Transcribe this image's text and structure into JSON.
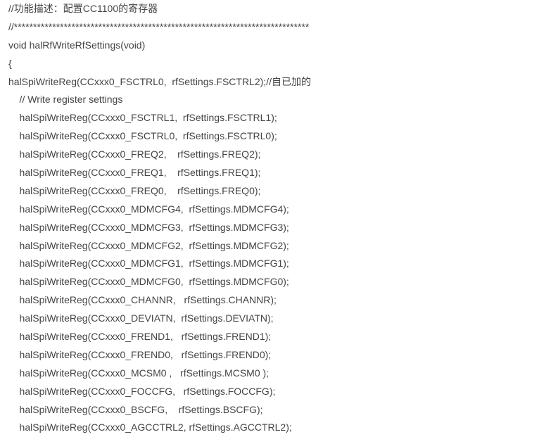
{
  "lines": [
    "//功能描述：配置CC1100的寄存器",
    "//*****************************************************************************",
    "void halRfWriteRfSettings(void)",
    "{",
    "halSpiWriteReg(CCxxx0_FSCTRL0,  rfSettings.FSCTRL2);//自已加的",
    "    // Write register settings",
    "    halSpiWriteReg(CCxxx0_FSCTRL1,  rfSettings.FSCTRL1);",
    "    halSpiWriteReg(CCxxx0_FSCTRL0,  rfSettings.FSCTRL0);",
    "    halSpiWriteReg(CCxxx0_FREQ2,    rfSettings.FREQ2);",
    "    halSpiWriteReg(CCxxx0_FREQ1,    rfSettings.FREQ1);",
    "    halSpiWriteReg(CCxxx0_FREQ0,    rfSettings.FREQ0);",
    "    halSpiWriteReg(CCxxx0_MDMCFG4,  rfSettings.MDMCFG4);",
    "    halSpiWriteReg(CCxxx0_MDMCFG3,  rfSettings.MDMCFG3);",
    "    halSpiWriteReg(CCxxx0_MDMCFG2,  rfSettings.MDMCFG2);",
    "    halSpiWriteReg(CCxxx0_MDMCFG1,  rfSettings.MDMCFG1);",
    "    halSpiWriteReg(CCxxx0_MDMCFG0,  rfSettings.MDMCFG0);",
    "    halSpiWriteReg(CCxxx0_CHANNR,   rfSettings.CHANNR);",
    "    halSpiWriteReg(CCxxx0_DEVIATN,  rfSettings.DEVIATN);",
    "    halSpiWriteReg(CCxxx0_FREND1,   rfSettings.FREND1);",
    "    halSpiWriteReg(CCxxx0_FREND0,   rfSettings.FREND0);",
    "    halSpiWriteReg(CCxxx0_MCSM0 ,   rfSettings.MCSM0 );",
    "    halSpiWriteReg(CCxxx0_FOCCFG,   rfSettings.FOCCFG);",
    "    halSpiWriteReg(CCxxx0_BSCFG,    rfSettings.BSCFG);",
    "    halSpiWriteReg(CCxxx0_AGCCTRL2, rfSettings.AGCCTRL2);"
  ]
}
